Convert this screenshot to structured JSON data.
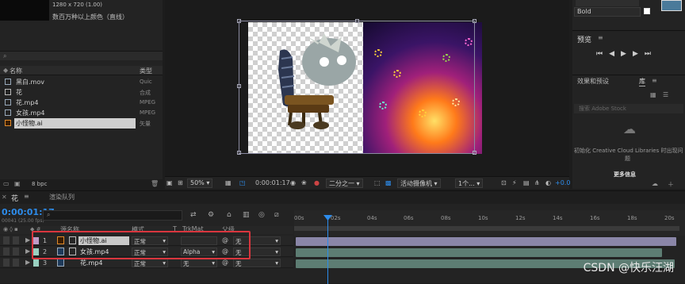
{
  "project": {
    "resolution": "1280 x 720 (1.00)",
    "color_desc": "数百万种以上颜色（直线）",
    "columns": {
      "name": "名称",
      "type": "类型"
    },
    "items": [
      {
        "name": "黑白.mov",
        "type": "Quic",
        "icon": "movie-icon"
      },
      {
        "name": "花",
        "type": "合成",
        "icon": "composition-icon"
      },
      {
        "name": "花.mp4",
        "type": "MPEG",
        "icon": "video-file-icon"
      },
      {
        "name": "女孩.mp4",
        "type": "MPEG",
        "icon": "video-file-icon"
      },
      {
        "name": "小怪物.ai",
        "type": "矢量",
        "icon": "illustrator-file-icon",
        "selected": true
      }
    ],
    "bpc": "8 bpc"
  },
  "viewer": {
    "zoom": "50%",
    "timecode": "0:00:01:17",
    "resolution": "二分之一",
    "camera": "活动摄像机",
    "views": "1个...",
    "exposure": "+0.0"
  },
  "right": {
    "font_style": "Bold",
    "preview_title": "预览",
    "effects_tab": "效果和预设",
    "library_tab": "库",
    "adobe_stock_search": "搜索 Adobe Stock",
    "cc_message_line1": "初始化 Creative Cloud Libraries 时出现问",
    "cc_message_line2": "题",
    "more_info": "更多信息"
  },
  "timeline": {
    "comp_tab": "花",
    "render_queue_tab": "渲染队列",
    "timecode": "0:00:01:17",
    "timecode_sub": "00041 (25.00 fps)",
    "headers": {
      "source_name": "源名称",
      "mode": "模式",
      "t": "T",
      "trkmat": "TrkMat",
      "parent": "父级"
    },
    "ruler_ticks": [
      "00s",
      "02s",
      "04s",
      "06s",
      "08s",
      "10s",
      "12s",
      "14s",
      "16s",
      "18s",
      "20s"
    ],
    "layers": [
      {
        "index": "1",
        "name": "小怪物.ai",
        "mode": "正常",
        "trkmat": "",
        "parent": "无"
      },
      {
        "index": "2",
        "name": "女孩.mp4",
        "mode": "正常",
        "trkmat": "Alpha",
        "parent": "无"
      },
      {
        "index": "3",
        "name": "花.mp4",
        "mode": "正常",
        "trkmat": "无",
        "parent": "无"
      }
    ]
  },
  "watermark": "CSDN @快乐汪湖"
}
